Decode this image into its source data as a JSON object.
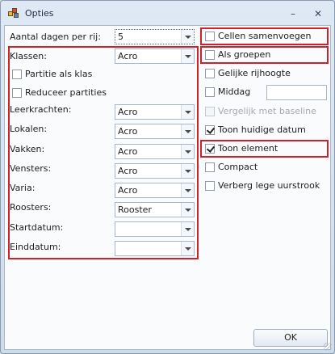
{
  "window": {
    "title": "Opties"
  },
  "left": {
    "rows_per_day": {
      "label": "Aantal dagen per rij:",
      "value": "5"
    },
    "klassen": {
      "label": "Klassen:",
      "value": "Acro"
    },
    "partitie_als_klas": {
      "label": "Partitie als klas",
      "checked": false
    },
    "reduceer_partities": {
      "label": "Reduceer partities",
      "checked": false
    },
    "leerkrachten": {
      "label": "Leerkrachten:",
      "value": "Acro"
    },
    "lokalen": {
      "label": "Lokalen:",
      "value": "Acro"
    },
    "vakken": {
      "label": "Vakken:",
      "value": "Acro"
    },
    "vensters": {
      "label": "Vensters:",
      "value": "Acro"
    },
    "varia": {
      "label": "Varia:",
      "value": "Acro"
    },
    "roosters": {
      "label": "Roosters:",
      "value": "Rooster"
    },
    "startdatum": {
      "label": "Startdatum:",
      "value": ""
    },
    "einddatum": {
      "label": "Einddatum:",
      "value": ""
    }
  },
  "right": {
    "cellen_samenvoegen": {
      "label": "Cellen samenvoegen",
      "checked": false
    },
    "als_groepen": {
      "label": "Als groepen",
      "checked": false
    },
    "gelijke_rijhoogte": {
      "label": "Gelijke rijhoogte",
      "checked": false
    },
    "middag": {
      "label": "Middag",
      "checked": false,
      "value": ""
    },
    "vergelijk_met_baseline": {
      "label": "Vergelijk met baseline",
      "checked": false,
      "disabled": true
    },
    "toon_huidige_datum": {
      "label": "Toon huidige datum",
      "checked": true
    },
    "toon_element": {
      "label": "Toon element",
      "checked": true
    },
    "compact": {
      "label": "Compact",
      "checked": false
    },
    "verberg_lege_uurstrook": {
      "label": "Verberg lege uurstrook",
      "checked": false
    }
  },
  "footer": {
    "ok_label": "OK"
  },
  "colors": {
    "highlight_frame": "#d0202a",
    "window_chrome": "#cfdcec"
  }
}
